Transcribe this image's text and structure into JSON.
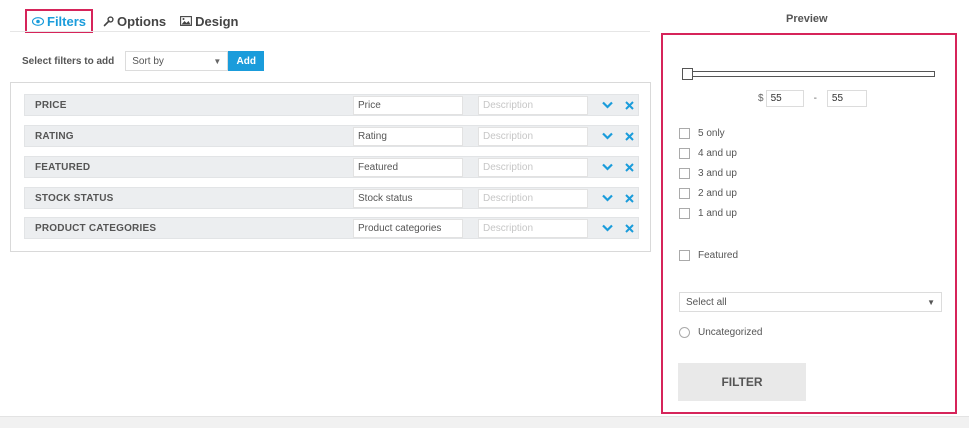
{
  "tabs": [
    {
      "label": "Filters",
      "icon": "eye-icon",
      "active": true
    },
    {
      "label": "Options",
      "icon": "wrench-icon",
      "active": false
    },
    {
      "label": "Design",
      "icon": "image-icon",
      "active": false
    }
  ],
  "add_filters": {
    "label": "Select filters to add",
    "select_value": "Sort by",
    "button_label": "Add"
  },
  "filters": [
    {
      "name": "PRICE",
      "title": "Price",
      "description_placeholder": "Description"
    },
    {
      "name": "RATING",
      "title": "Rating",
      "description_placeholder": "Description"
    },
    {
      "name": "FEATURED",
      "title": "Featured",
      "description_placeholder": "Description"
    },
    {
      "name": "STOCK STATUS",
      "title": "Stock status",
      "description_placeholder": "Description"
    },
    {
      "name": "PRODUCT CATEGORIES",
      "title": "Product categories",
      "description_placeholder": "Description"
    }
  ],
  "preview": {
    "title": "Preview",
    "price": {
      "currency": "$",
      "min": "55",
      "max": "55",
      "separator": "-"
    },
    "rating_options": [
      "5 only",
      "4 and up",
      "3 and up",
      "2 and up",
      "1 and up"
    ],
    "featured_label": "Featured",
    "category_select": "Select all",
    "category_option": "Uncategorized",
    "filter_button": "FILTER"
  },
  "colors": {
    "accent": "#1a9cdb",
    "highlight_border": "#d6245a",
    "row_bg": "#eceef0"
  }
}
